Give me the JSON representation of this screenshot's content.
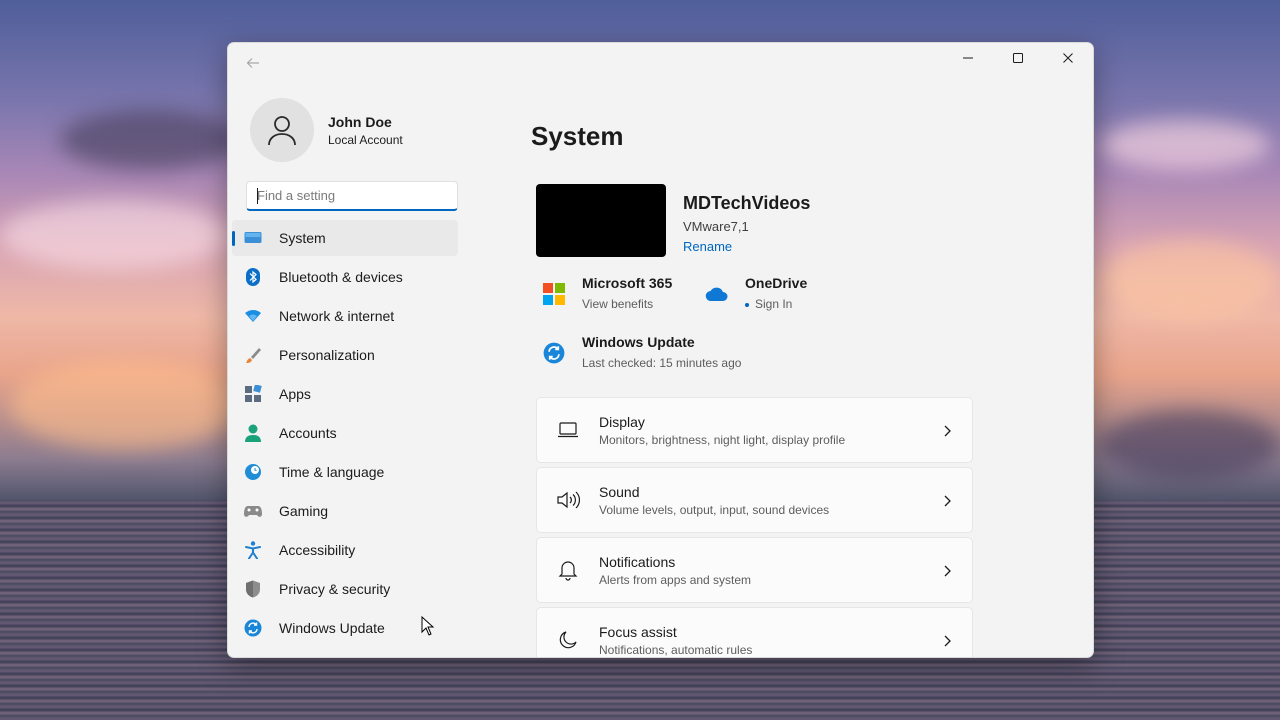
{
  "window": {
    "back_icon": "back-arrow-icon",
    "controls": [
      "minimize-icon",
      "maximize-icon",
      "close-icon"
    ]
  },
  "profile": {
    "name": "John Doe",
    "account_type": "Local Account",
    "avatar_icon": "person-icon"
  },
  "search": {
    "placeholder": "Find a setting",
    "value": ""
  },
  "sidebar": {
    "items": [
      {
        "label": "System",
        "icon": "monitor-icon",
        "active": true
      },
      {
        "label": "Bluetooth & devices",
        "icon": "bluetooth-icon"
      },
      {
        "label": "Network & internet",
        "icon": "wifi-icon"
      },
      {
        "label": "Personalization",
        "icon": "brush-icon"
      },
      {
        "label": "Apps",
        "icon": "apps-icon"
      },
      {
        "label": "Accounts",
        "icon": "accounts-icon"
      },
      {
        "label": "Time & language",
        "icon": "globe-clock-icon"
      },
      {
        "label": "Gaming",
        "icon": "gamepad-icon"
      },
      {
        "label": "Accessibility",
        "icon": "accessibility-icon"
      },
      {
        "label": "Privacy & security",
        "icon": "shield-icon"
      },
      {
        "label": "Windows Update",
        "icon": "update-icon"
      }
    ]
  },
  "main": {
    "title": "System",
    "device": {
      "name": "MDTechVideos",
      "model": "VMware7,1",
      "rename": "Rename"
    },
    "tiles": {
      "m365": {
        "title": "Microsoft 365",
        "subtitle": "View benefits",
        "icon": "microsoft-logo-icon"
      },
      "onedrive": {
        "title": "OneDrive",
        "subtitle": "Sign In",
        "icon": "cloud-icon"
      },
      "update": {
        "title": "Windows Update",
        "subtitle": "Last checked: 15 minutes ago",
        "icon": "update-icon"
      }
    },
    "cards": [
      {
        "title": "Display",
        "subtitle": "Monitors, brightness, night light, display profile",
        "icon": "laptop-icon"
      },
      {
        "title": "Sound",
        "subtitle": "Volume levels, output, input, sound devices",
        "icon": "speaker-icon"
      },
      {
        "title": "Notifications",
        "subtitle": "Alerts from apps and system",
        "icon": "bell-icon"
      },
      {
        "title": "Focus assist",
        "subtitle": "Notifications, automatic rules",
        "icon": "moon-icon"
      }
    ]
  },
  "colors": {
    "accent": "#0067c0",
    "window_bg": "#f3f3f3",
    "card_bg": "#fbfbfb"
  }
}
